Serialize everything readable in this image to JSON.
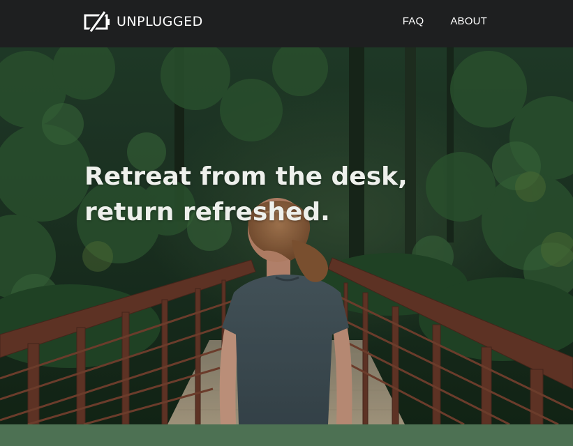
{
  "header": {
    "brand_name": "UNPLUGGED",
    "brand_icon": "unplugged-battery-icon",
    "nav": {
      "faq_label": "FAQ",
      "about_label": "ABOUT"
    }
  },
  "hero": {
    "headline_line1": "Retreat from the desk,",
    "headline_line2": "return refreshed.",
    "image_subject": "woman-on-forest-bridge-photo"
  },
  "colors": {
    "header_bg": "#1e1f20",
    "text": "#ffffff",
    "accent_green": "#4d7153"
  }
}
